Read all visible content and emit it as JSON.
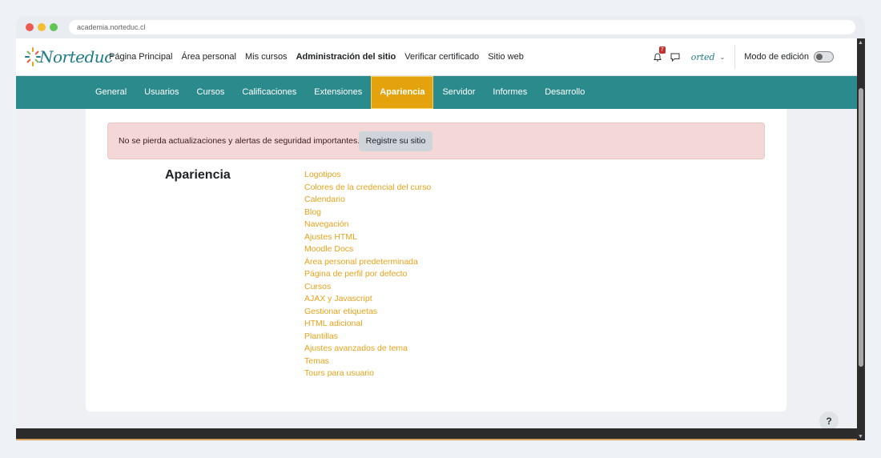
{
  "browser": {
    "url": "academia.norteduc.cl"
  },
  "brand": {
    "logo_text": "Norteduc",
    "user_logo_text": "orted",
    "accent": "#2b8a8b",
    "active_tab_color": "#e4a30c",
    "link_color": "#e8a21b"
  },
  "topnav": {
    "links": [
      {
        "label": "Página Principal"
      },
      {
        "label": "Área personal"
      },
      {
        "label": "Mis cursos"
      },
      {
        "label": "Administración del sitio"
      },
      {
        "label": "Verificar certificado"
      },
      {
        "label": "Sitio web"
      }
    ],
    "notifications_count": "7",
    "edit_mode_label": "Modo de edición",
    "edit_mode_on": false
  },
  "secondary_nav": {
    "tabs": [
      {
        "label": "General"
      },
      {
        "label": "Usuarios"
      },
      {
        "label": "Cursos"
      },
      {
        "label": "Calificaciones"
      },
      {
        "label": "Extensiones"
      },
      {
        "label": "Apariencia"
      },
      {
        "label": "Servidor"
      },
      {
        "label": "Informes"
      },
      {
        "label": "Desarrollo"
      }
    ]
  },
  "alert": {
    "message": "No se pierda actualizaciones y alertas de seguridad importantes.",
    "button_label": "Registre su sitio"
  },
  "section": {
    "title": "Apariencia",
    "links": [
      "Logotipos",
      "Colores de la credencial del curso",
      "Calendario",
      "Blog",
      "Navegación",
      "Ajustes HTML",
      "Moodle Docs",
      "Área personal predeterminada",
      "Página de perfil por defecto",
      "Cursos",
      "AJAX y Javascript",
      "Gestionar etiquetas",
      "HTML adicional",
      "Plantillas",
      "Ajustes avanzados de tema",
      "Temas",
      "Tours para usuario"
    ]
  },
  "help_label": "?"
}
